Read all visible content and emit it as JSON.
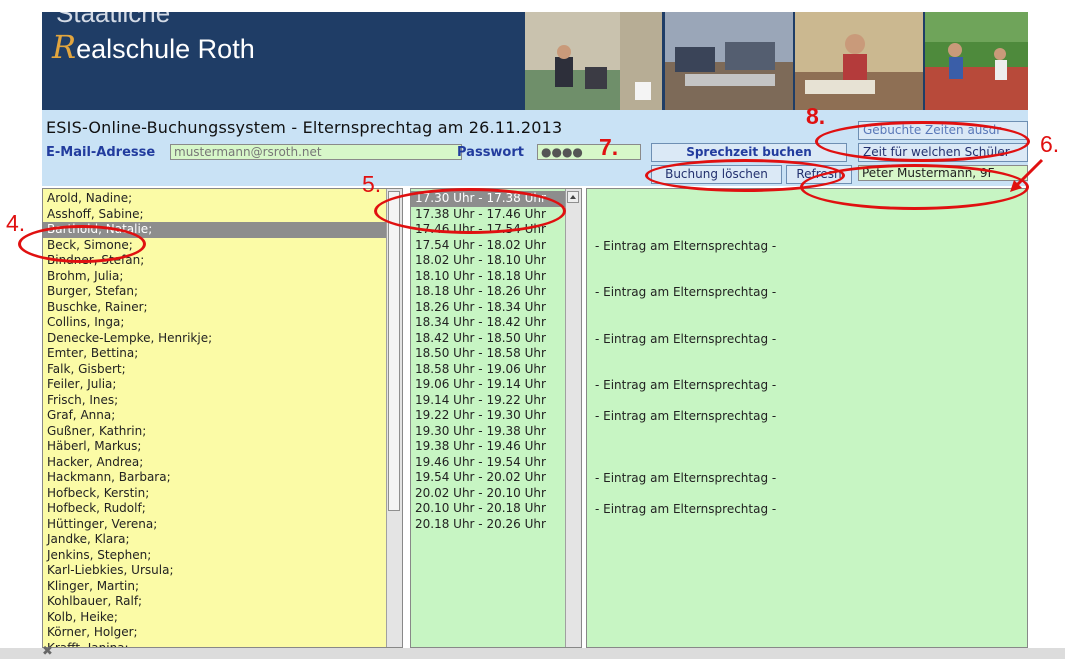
{
  "banner": {
    "school_top": "Staatliche",
    "school_initial": "R",
    "school_name": "ealschule Roth"
  },
  "header": {
    "title": "ESIS-Online-Buchungssystem - Elternsprechtag am 26.11.2013",
    "email_label": "E-Mail-Adresse",
    "email_value": "mustermann@rsroth.net",
    "password_label": "Passwort",
    "password_value": "●●●●",
    "book_button": "Sprechzeit buchen",
    "delete_button": "Buchung löschen",
    "refresh_button": "Refresh",
    "print_button": "Gebuchte Zeiten ausdr",
    "student_button": "Zeit für welchen Schüler",
    "student_select": "Peter Mustermann, 9F"
  },
  "teachers": [
    "Arold, Nadine;",
    "Asshoff, Sabine;",
    "Barthold, Natalie;",
    "Beck, Simone;",
    "Bindner, Stefan;",
    "Brohm, Julia;",
    "Burger, Stefan;",
    "Buschke, Rainer;",
    "Collins, Inga;",
    "Denecke-Lempke, Henrikje;",
    "Emter, Bettina;",
    "Falk, Gisbert;",
    "Feiler, Julia;",
    "Frisch, Ines;",
    "Graf, Anna;",
    "Gußner, Kathrin;",
    "Häberl, Markus;",
    "Hacker, Andrea;",
    "Hackmann, Barbara;",
    "Hofbeck, Kerstin;",
    "Hofbeck, Rudolf;",
    "Hüttinger, Verena;",
    "Jandke, Klara;",
    "Jenkins, Stephen;",
    "Karl-Liebkies, Ursula;",
    "Klinger, Martin;",
    "Kohlbauer, Ralf;",
    "Kolb, Heike;",
    "Körner, Holger;",
    "Krafft, Janina;"
  ],
  "selected_teacher_index": 2,
  "times": [
    "17.30 Uhr - 17.38 Uhr",
    "17.38 Uhr - 17.46 Uhr",
    "17.46 Uhr - 17.54 Uhr",
    "17.54 Uhr - 18.02 Uhr",
    "18.02 Uhr - 18.10 Uhr",
    "18.10 Uhr - 18.18 Uhr",
    "18.18 Uhr - 18.26 Uhr",
    "18.26 Uhr - 18.34 Uhr",
    "18.34 Uhr - 18.42 Uhr",
    "18.42 Uhr - 18.50 Uhr",
    "18.50 Uhr - 18.58 Uhr",
    "18.58 Uhr - 19.06 Uhr",
    "19.06 Uhr - 19.14 Uhr",
    "19.14 Uhr - 19.22 Uhr",
    "19.22 Uhr - 19.30 Uhr",
    "19.30 Uhr - 19.38 Uhr",
    "19.38 Uhr - 19.46 Uhr",
    "19.46 Uhr - 19.54 Uhr",
    "19.54 Uhr - 20.02 Uhr",
    "20.02 Uhr - 20.10 Uhr",
    "20.10 Uhr - 20.18 Uhr",
    "20.18 Uhr - 20.26 Uhr"
  ],
  "selected_time_index": 0,
  "entries": [
    {
      "slot": 3,
      "text": "- Eintrag am Elternsprechtag -"
    },
    {
      "slot": 6,
      "text": "- Eintrag am Elternsprechtag -"
    },
    {
      "slot": 9,
      "text": "- Eintrag am Elternsprechtag -"
    },
    {
      "slot": 12,
      "text": "- Eintrag am Elternsprechtag -"
    },
    {
      "slot": 14,
      "text": "- Eintrag am Elternsprechtag -"
    },
    {
      "slot": 18,
      "text": "- Eintrag am Elternsprechtag -"
    },
    {
      "slot": 20,
      "text": "- Eintrag am Elternsprechtag -"
    }
  ],
  "annotations": {
    "n4": "4.",
    "n5": "5.",
    "n6": "6.",
    "n7": "7.",
    "n8": "8.",
    "color": "#e01010"
  },
  "close_glyph": "✖"
}
